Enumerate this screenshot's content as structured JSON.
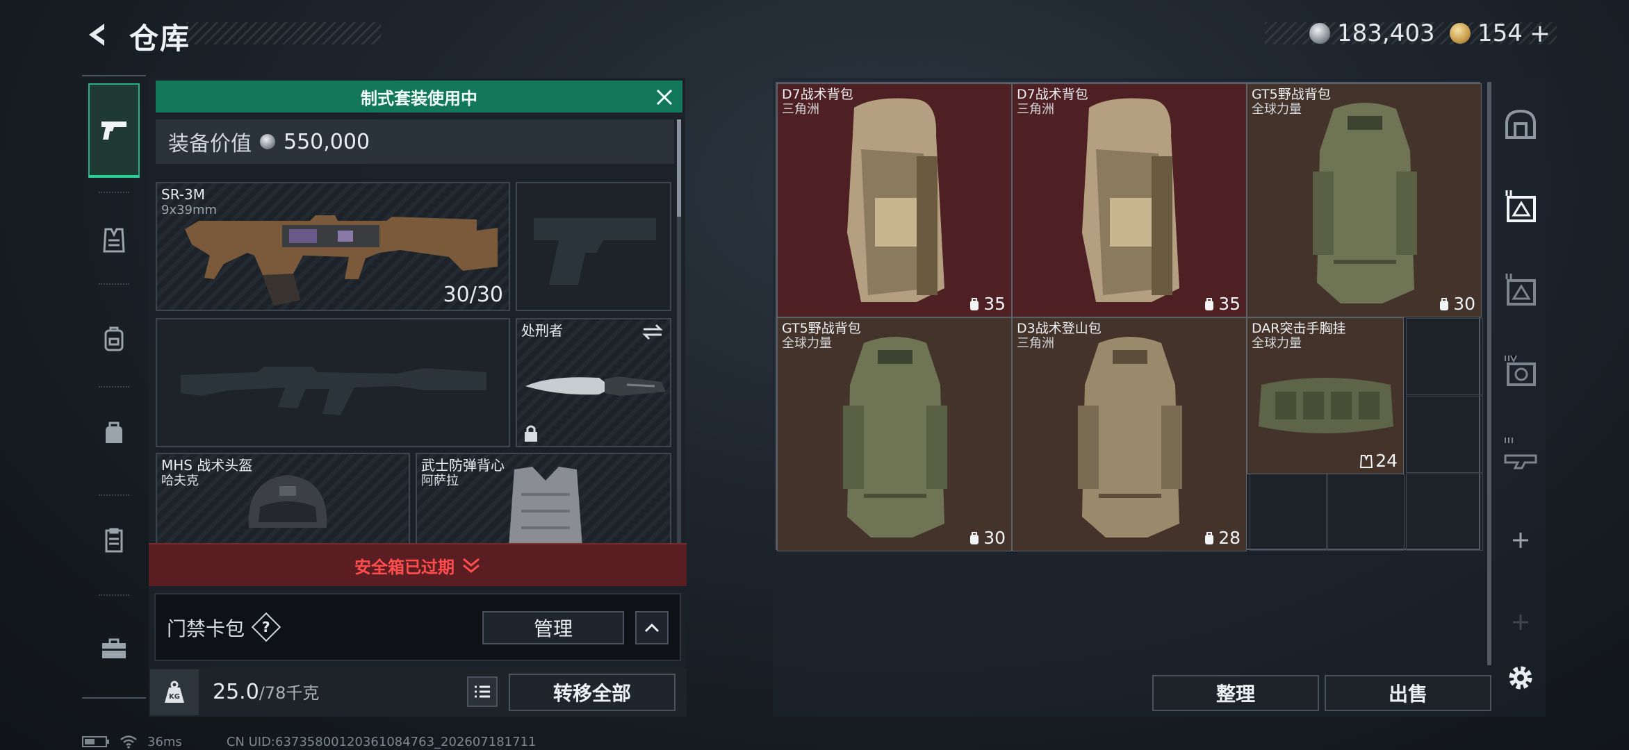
{
  "header": {
    "title": "仓库",
    "currencies": [
      {
        "icon": "silver-coin-icon",
        "value": "183,403",
        "color": "#c9cdd2"
      },
      {
        "icon": "gold-coin-icon",
        "value": "154",
        "suffix": "+",
        "color": "#d6b36a"
      }
    ]
  },
  "left_nav": [
    {
      "icon": "pistol-icon",
      "active": true
    },
    {
      "icon": "armor-vest-icon",
      "active": false
    },
    {
      "icon": "backpack-icon",
      "active": false
    },
    {
      "icon": "bag-icon",
      "active": false
    },
    {
      "icon": "clipboard-icon",
      "active": false
    },
    {
      "icon": "briefcase-icon",
      "active": false
    }
  ],
  "loadout": {
    "banner": "制式套装使用中",
    "value_label": "装备价值",
    "value": "550,000",
    "primary_weapon": {
      "name": "SR-3M",
      "ammo": "9x39mm",
      "count": "30/30"
    },
    "sidearm_slot": {
      "icon": "pistol-silhouette-icon"
    },
    "secondary_slot": {
      "icon": "rifle-silhouette-icon"
    },
    "melee": {
      "name": "处刑者",
      "icon": "knife-icon",
      "swap_icon": "swap-arrows-icon",
      "lock_icon": "lock-icon"
    },
    "helmet": {
      "name": "MHS 战术头盔",
      "sub": "哈夫克"
    },
    "armor": {
      "name": "武士防弹背心",
      "sub": "阿萨拉"
    },
    "safebox": "安全箱已过期",
    "keycard_label": "门禁卡包",
    "keycard_help": "?",
    "manage_label": "管理",
    "weight_current": "25.0",
    "weight_max": "/78千克",
    "transfer_label": "转移全部"
  },
  "stash": {
    "items": [
      {
        "name": "D7战术背包",
        "sub": "三角洲",
        "capacity": "35",
        "theme": "red",
        "cap_icon": "backpack-cap-icon"
      },
      {
        "name": "D7战术背包",
        "sub": "三角洲",
        "capacity": "35",
        "theme": "red",
        "cap_icon": "backpack-cap-icon"
      },
      {
        "name": "GT5野战背包",
        "sub": "全球力量",
        "capacity": "30",
        "theme": "brown",
        "cap_icon": "backpack-cap-icon"
      },
      {
        "name": "GT5野战背包",
        "sub": "全球力量",
        "capacity": "30",
        "theme": "brown",
        "cap_icon": "backpack-cap-icon"
      },
      {
        "name": "D3战术登山包",
        "sub": "三角洲",
        "capacity": "28",
        "theme": "brown",
        "cap_icon": "backpack-cap-icon"
      },
      {
        "name": "DAR突击手胸挂",
        "sub": "全球力量",
        "capacity": "24",
        "theme": "brown",
        "cap_icon": "vest-cap-icon"
      }
    ],
    "sort_label": "整理",
    "sell_label": "出售"
  },
  "right_nav": [
    {
      "icon": "safebox-icon"
    },
    {
      "icon": "stash-page-1-icon",
      "active": true
    },
    {
      "icon": "stash-page-2-icon"
    },
    {
      "icon": "stash-page-4-icon"
    },
    {
      "icon": "stash-page-3-icon"
    },
    {
      "icon": "add-page-icon"
    },
    {
      "icon": "add-page-disabled-icon"
    },
    {
      "icon": "gear-icon"
    }
  ],
  "status_bar": {
    "ping": "36ms",
    "uid": "CN UID:637358001203610847​63_202607181711"
  }
}
